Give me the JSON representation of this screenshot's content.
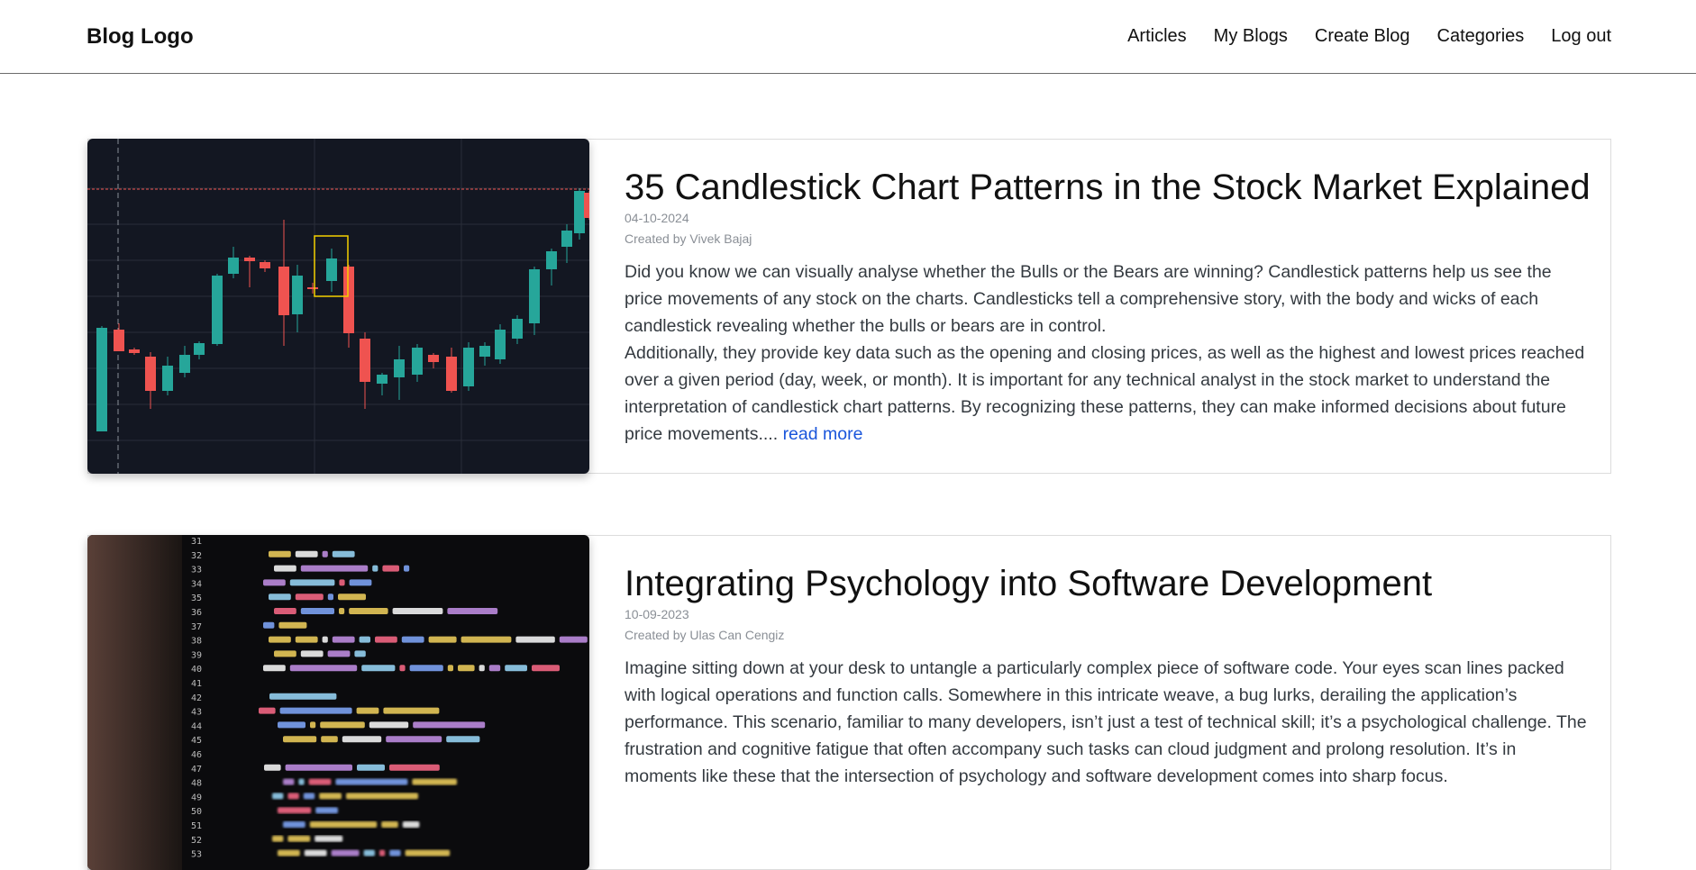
{
  "brand": "Blog Logo",
  "nav": [
    "Articles",
    "My Blogs",
    "Create Blog",
    "Categories",
    "Log out"
  ],
  "posts": [
    {
      "title": "35 Candlestick Chart Patterns in the Stock Market Explained",
      "date": "04-10-2024",
      "author": "Created by Vivek Bajaj",
      "paragraphs": [
        "Did you know we can visually analyse whether the Bulls or the Bears are winning? Candlestick patterns help us see the price movements of any stock on the charts. Candlesticks tell a comprehensive story, with the body and wicks of each candlestick revealing whether the bulls or bears are in control.",
        "Additionally, they provide key data such as the opening and closing prices, as well as the highest and lowest prices reached over a given period (day, week, or month). It is important for any technical analyst in the stock market to understand the interpretation of candlestick chart patterns. By recognizing these patterns, they can make informed decisions about future price movements...."
      ],
      "read_more": "read more"
    },
    {
      "title": "Integrating Psychology into Software Development",
      "date": "10-09-2023",
      "author": "Created by Ulas Can Cengiz",
      "paragraphs": [
        "Imagine sitting down at your desk to untangle a particularly complex piece of software code. Your eyes scan lines packed with logical operations and function calls. Somewhere in this intricate weave, a bug lurks, derailing the application’s performance. This scenario, familiar to many developers, isn’t just a test of technical skill; it’s a psychological challenge. The frustration and cognitive fatigue that often accompany such tasks can cloud judgment and prolong resolution. It’s in moments like these that the intersection of psychology and software development comes into sharp focus."
      ]
    }
  ],
  "code_lines": [
    "31",
    "32 self.file = None",
    "33 self.fingerprints = set()",
    "34 self.logdupes = True",
    "35 self.debug = debug",
    "36 self.logger = logging.getLogger(__name__)",
    "37 if path:",
    "38 self.file = open(os.path.join(path, 'requests.seen'), 'a+')",
    "39 self.file.seek(0)",
    "40 self.fingerprints.update(x.rstrip() for x in self.file)",
    "41",
    "42 @classmethod",
    "43 def from_settings(cls, settings):",
    "44 debug = settings.getbool('DUPEFILTER_DEBUG')",
    "45 return cls(job_dir(settings), debug)",
    "46",
    "47 def request_seen(self, request):",
    "48 fp = self.request_fingerprint(request)",
    "49 if fp in self.fingerprints:",
    "50 return True",
    "51 self.fingerprints.add(fp)",
    "52 if self.file:",
    "53 self.file.write(fp + os.linesep)"
  ],
  "colors": {
    "bull": "#26a69a",
    "bear": "#ef5350",
    "chart_bg": "#131722",
    "link": "#1a56db"
  }
}
